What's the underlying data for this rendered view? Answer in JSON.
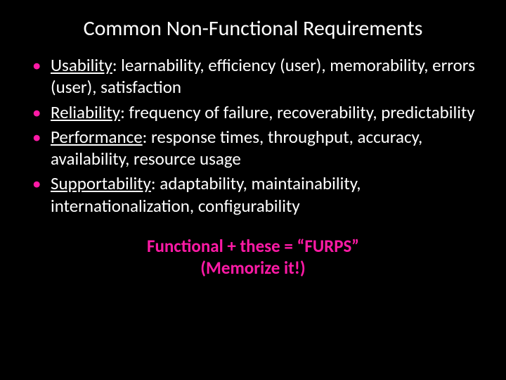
{
  "title": "Common Non-Functional Requirements",
  "bullets": [
    {
      "term": "Usability",
      "rest": ": learnability, efficiency (user), memorability, errors (user), satisfaction"
    },
    {
      "term": "Reliability",
      "rest": ": frequency of failure, recoverability, predictability"
    },
    {
      "term": "Performance",
      "rest": ": response times, throughput, accuracy, availability, resource usage"
    },
    {
      "term": "Supportability",
      "rest": ": adaptability, maintainability, internationalization, configurability"
    }
  ],
  "footer": {
    "line1": "Functional + these = “FURPS”",
    "line2": "(Memorize it!)"
  }
}
